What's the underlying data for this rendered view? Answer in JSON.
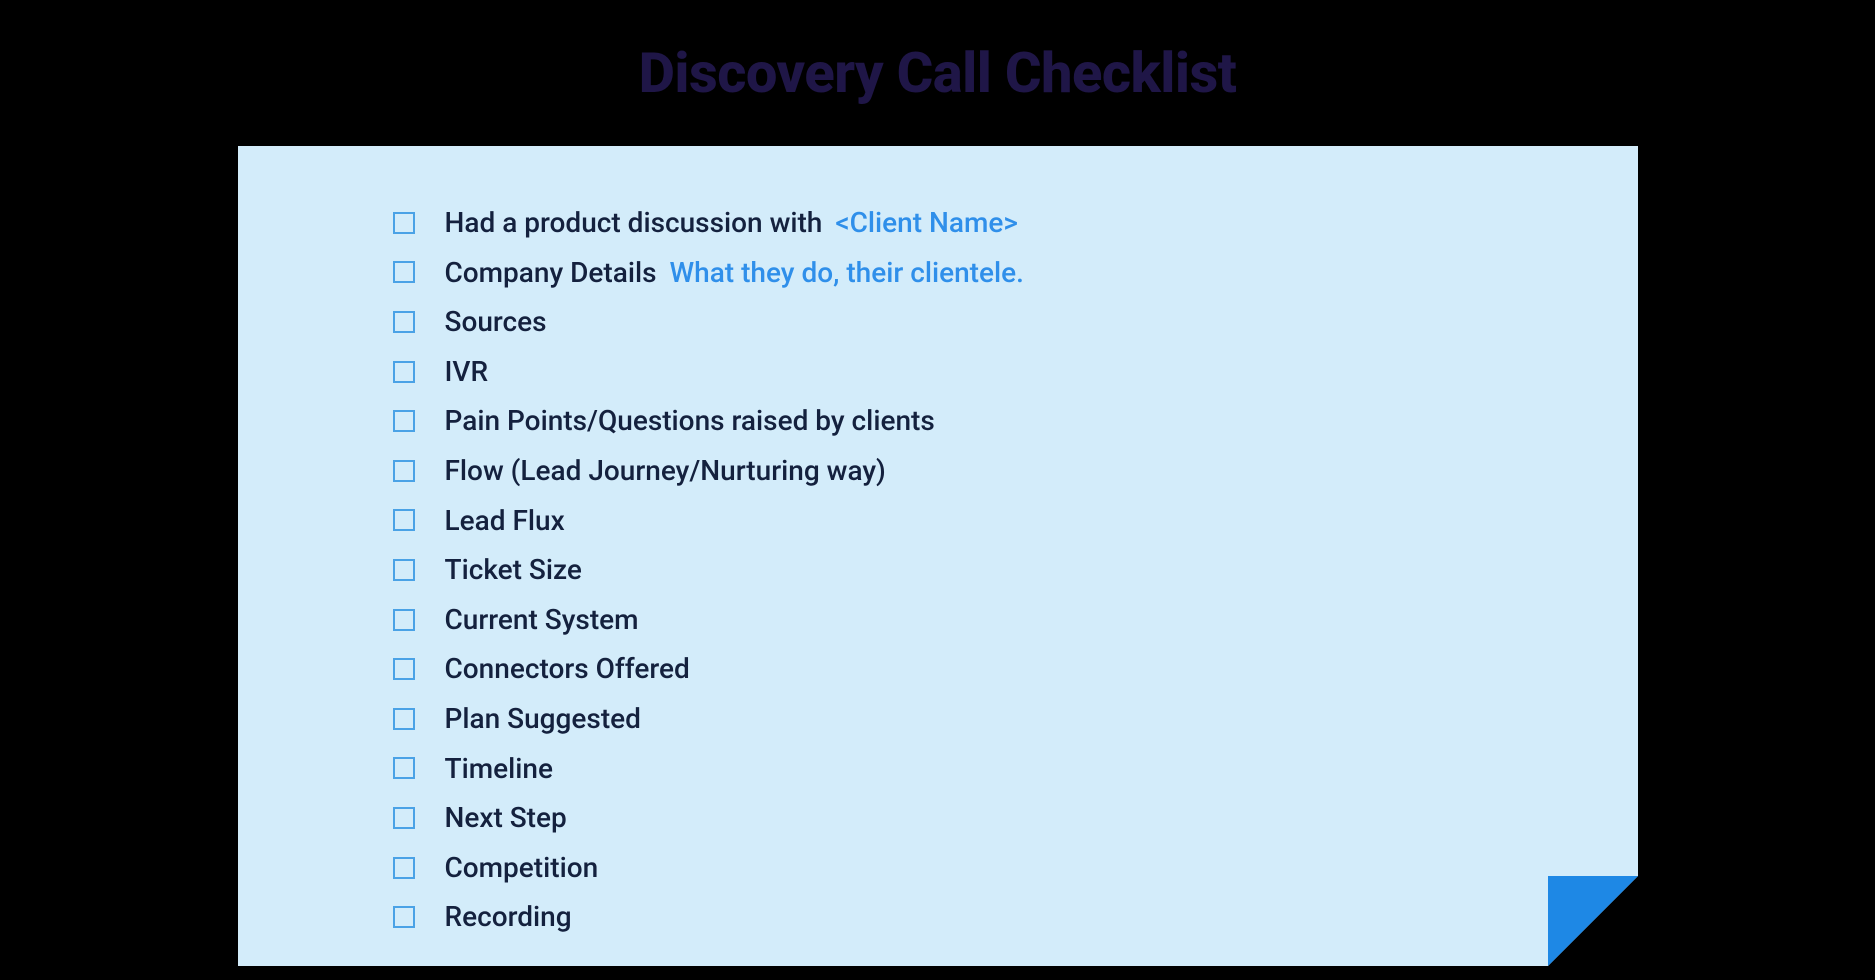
{
  "title": "Discovery Call Checklist",
  "colors": {
    "background": "#000000",
    "card": "#d3ecfa",
    "title": "#1f1647",
    "text": "#14213e",
    "accent": "#2f8fea",
    "checkbox": "#4aa2e6",
    "fold": "#1e88e5"
  },
  "checklist": [
    {
      "label": "Had a product discussion with",
      "hint": "<Client Name>"
    },
    {
      "label": "Company Details",
      "hint": "What they do, their clientele."
    },
    {
      "label": "Sources",
      "hint": ""
    },
    {
      "label": "IVR",
      "hint": ""
    },
    {
      "label": "Pain Points/Questions raised by clients",
      "hint": ""
    },
    {
      "label": "Flow (Lead Journey/Nurturing way)",
      "hint": ""
    },
    {
      "label": "Lead Flux",
      "hint": ""
    },
    {
      "label": "Ticket Size",
      "hint": ""
    },
    {
      "label": "Current System",
      "hint": ""
    },
    {
      "label": "Connectors Offered",
      "hint": ""
    },
    {
      "label": "Plan Suggested",
      "hint": ""
    },
    {
      "label": "Timeline",
      "hint": ""
    },
    {
      "label": "Next Step",
      "hint": ""
    },
    {
      "label": "Competition",
      "hint": ""
    },
    {
      "label": "Recording",
      "hint": ""
    }
  ]
}
